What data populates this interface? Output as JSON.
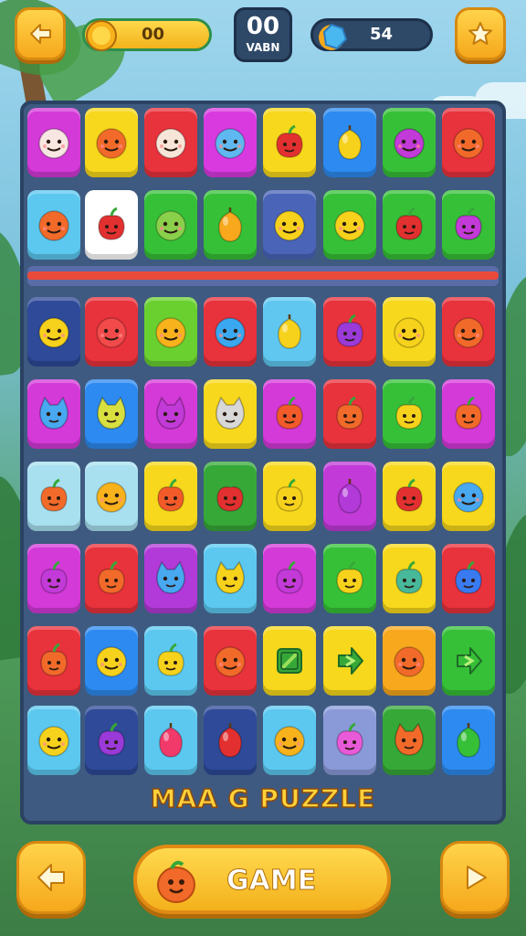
{
  "header": {
    "coins": "00",
    "level_number": "00",
    "level_label": "VABN",
    "gems": "54"
  },
  "footer": {
    "game_button_label": "GAME"
  },
  "board": {
    "title": "MAA G PUZZLE",
    "rows": [
      [
        {
          "color": "#d43ad8",
          "kind": "face",
          "face": "#f7e6e2"
        },
        {
          "color": "#f7d81c",
          "kind": "face",
          "face": "#f26a2a"
        },
        {
          "color": "#e8323c",
          "kind": "face",
          "face": "#f7e6d8"
        },
        {
          "color": "#d83ae0",
          "kind": "face",
          "face": "#60b8f0"
        },
        {
          "color": "#f7d81c",
          "kind": "apple",
          "face": "#e23030"
        },
        {
          "color": "#2d8af0",
          "kind": "fruit",
          "face": "#f7d21c"
        },
        {
          "color": "#36c038",
          "kind": "face",
          "face": "#c23ad8"
        },
        {
          "color": "#e8323c",
          "kind": "face",
          "face": "#f26a2a"
        }
      ],
      [
        {
          "color": "#5cc8f0",
          "kind": "face",
          "face": "#f26a2a"
        },
        {
          "color": "#ffffff",
          "kind": "apple",
          "face": "#e23030"
        },
        {
          "color": "#36c038",
          "kind": "face",
          "face": "#8ad04a"
        },
        {
          "color": "#36c038",
          "kind": "fruit",
          "face": "#f7a81c"
        },
        {
          "color": "#4a64b8",
          "kind": "face",
          "face": "#f7d21c"
        },
        {
          "color": "#36c038",
          "kind": "face",
          "face": "#f7d21c"
        },
        {
          "color": "#36c038",
          "kind": "apple",
          "face": "#e23030"
        },
        {
          "color": "#36c038",
          "kind": "apple",
          "face": "#c23ad8"
        }
      ],
      [
        {
          "color": "#2e4a98",
          "kind": "face",
          "face": "#f7d21c"
        },
        {
          "color": "#e8323c",
          "kind": "face",
          "face": "#f24a4a"
        },
        {
          "color": "#6ad030",
          "kind": "face",
          "face": "#f7b21c"
        },
        {
          "color": "#e8323c",
          "kind": "face",
          "face": "#3aa8f0"
        },
        {
          "color": "#60c8f0",
          "kind": "fruit",
          "face": "#f7d21c"
        },
        {
          "color": "#e8323c",
          "kind": "apple",
          "face": "#9a3ad8"
        },
        {
          "color": "#f7d81c",
          "kind": "face",
          "face": "#f7d21c"
        },
        {
          "color": "#e8323c",
          "kind": "face",
          "face": "#f26a2a"
        }
      ],
      [
        {
          "color": "#d43ad8",
          "kind": "cat",
          "face": "#48a8f0"
        },
        {
          "color": "#2d8af0",
          "kind": "cat",
          "face": "#d8e040"
        },
        {
          "color": "#d43ad8",
          "kind": "cat",
          "face": "#c23ad8"
        },
        {
          "color": "#f7d81c",
          "kind": "cat",
          "face": "#d8d8d8"
        },
        {
          "color": "#d43ad8",
          "kind": "apple",
          "face": "#f25a2a"
        },
        {
          "color": "#e8323c",
          "kind": "apple",
          "face": "#f26a2a"
        },
        {
          "color": "#36c038",
          "kind": "apple",
          "face": "#f7d21c"
        },
        {
          "color": "#d43ad8",
          "kind": "apple",
          "face": "#f26a2a"
        }
      ],
      [
        {
          "color": "#a8e0f0",
          "kind": "apple",
          "face": "#f26a2a"
        },
        {
          "color": "#a8e0f0",
          "kind": "face",
          "face": "#f7b21c"
        },
        {
          "color": "#f7d81c",
          "kind": "apple",
          "face": "#f25a2a"
        },
        {
          "color": "#36a838",
          "kind": "apple",
          "face": "#e23030"
        },
        {
          "color": "#f7d81c",
          "kind": "apple",
          "face": "#f7d21c"
        },
        {
          "color": "#c23ad8",
          "kind": "fruit",
          "face": "#b23ad8"
        },
        {
          "color": "#f7d81c",
          "kind": "apple",
          "face": "#e23030"
        },
        {
          "color": "#f7d81c",
          "kind": "face",
          "face": "#48a8f0"
        }
      ],
      [
        {
          "color": "#d43ad8",
          "kind": "apple",
          "face": "#c23ad8"
        },
        {
          "color": "#e8323c",
          "kind": "apple",
          "face": "#f26a2a"
        },
        {
          "color": "#b23ad8",
          "kind": "cat",
          "face": "#48a8f0"
        },
        {
          "color": "#5cc8f0",
          "kind": "cat",
          "face": "#f7d21c"
        },
        {
          "color": "#d43ad8",
          "kind": "apple",
          "face": "#c23ad8"
        },
        {
          "color": "#36c038",
          "kind": "apple",
          "face": "#f7d21c"
        },
        {
          "color": "#f7d81c",
          "kind": "apple",
          "face": "#48b89a"
        },
        {
          "color": "#e8323c",
          "kind": "apple",
          "face": "#3a7af0"
        }
      ],
      [
        {
          "color": "#e8323c",
          "kind": "apple",
          "face": "#f26a2a"
        },
        {
          "color": "#2d8af0",
          "kind": "face",
          "face": "#f7d21c"
        },
        {
          "color": "#5cc8f0",
          "kind": "apple",
          "face": "#f7d21c"
        },
        {
          "color": "#e8323c",
          "kind": "face",
          "face": "#f26a2a"
        },
        {
          "color": "#f7d81c",
          "kind": "box",
          "face": "#36a838"
        },
        {
          "color": "#f7d81c",
          "kind": "arrow",
          "face": "#36a838"
        },
        {
          "color": "#f7a81c",
          "kind": "face",
          "face": "#f26a2a"
        },
        {
          "color": "#36c038",
          "kind": "arrow",
          "face": "#36c038"
        }
      ],
      [
        {
          "color": "#5cc8f0",
          "kind": "face",
          "face": "#f7d21c"
        },
        {
          "color": "#2e4a98",
          "kind": "apple",
          "face": "#9a3ad8"
        },
        {
          "color": "#5cc8f0",
          "kind": "fruit",
          "face": "#f23a6a"
        },
        {
          "color": "#2e4a98",
          "kind": "fruit",
          "face": "#e23030"
        },
        {
          "color": "#5cc8f0",
          "kind": "face",
          "face": "#f7b21c"
        },
        {
          "color": "#8a9ad8",
          "kind": "apple",
          "face": "#e85ad8"
        },
        {
          "color": "#36a838",
          "kind": "cat",
          "face": "#f26a2a"
        },
        {
          "color": "#2d8af0",
          "kind": "fruit",
          "face": "#36c038"
        }
      ]
    ]
  }
}
